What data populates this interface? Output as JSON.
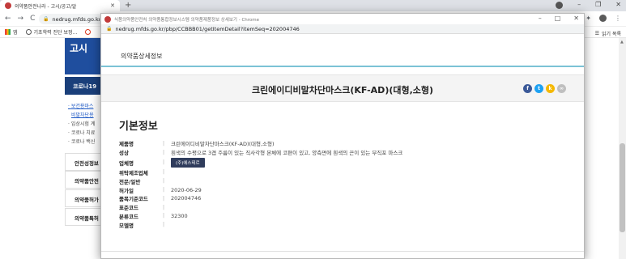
{
  "background": {
    "tab_title": "의약품안전나라 - 고시/공고/알",
    "url": "nedrug.mfds.go.kr",
    "bookmarks": [
      "앱",
      "기초학력 진단 보정..."
    ],
    "reading_list": "읽기 목록",
    "banner_text": "고시",
    "covid_label": "코로나19",
    "list_items": [
      "보건용마스",
      "비말차단용",
      "임상시험 계",
      "코로나 치료",
      "코로나 백신"
    ],
    "menu_items": [
      "안전성정보",
      "의약품안전",
      "의약품허가",
      "의약품특허"
    ]
  },
  "popup": {
    "window_title": "식품의약품안전처 의약품통합정보시스템 의약품제품정보 상세보기 - Chrome",
    "url": "nedrug.mfds.go.kr/pbp/CCBBB01/getItemDetail?itemSeq=202004746",
    "header": "의약품상세정보",
    "product_name": "크린에이디비말차단마스크(KF-AD)(대형,소형)",
    "section_title": "기본정보",
    "fields": {
      "product_label": "제품명",
      "product_value": "크린에이디비말차단마스크(KF-AD)(대형,소형)",
      "shape_label": "성상",
      "shape_value": "흰색의 수평으로 3겹 주름이 있는 직사각형 본체에 코편이 있고, 양측면에 흰색의 끈이 있는 부직포 마스크",
      "company_label": "업체명",
      "company_value": "(주)에스테르",
      "consign_label": "위탁제조업체",
      "type_label": "전문/일반",
      "date_label": "허가일",
      "date_value": "2020-06-29",
      "code_label": "품목기준코드",
      "code_value": "202004746",
      "std_label": "표준코드",
      "class_label": "분류코드",
      "class_value": "32300",
      "model_label": "모델명"
    },
    "share_colors": [
      "#3b5998",
      "#1da1f2",
      "#f5b800",
      "#bfbfbf"
    ]
  }
}
